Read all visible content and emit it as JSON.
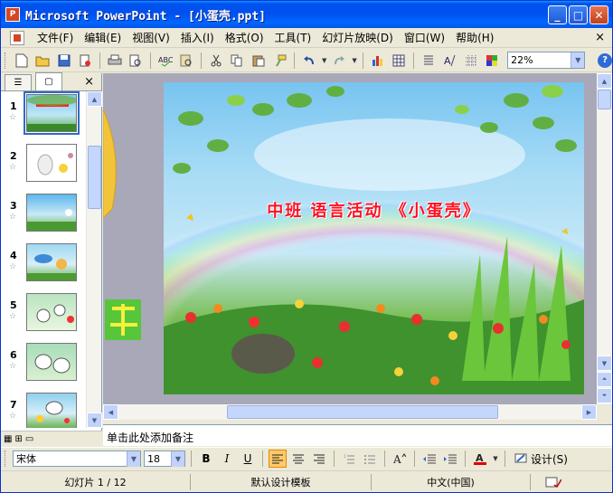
{
  "window": {
    "app_icon": "P",
    "title": "Microsoft PowerPoint - [小蛋壳.ppt]",
    "buttons": [
      "_",
      "□",
      "✕"
    ]
  },
  "menu": {
    "items": [
      "文件(F)",
      "编辑(E)",
      "视图(V)",
      "插入(I)",
      "格式(O)",
      "工具(T)",
      "幻灯片放映(D)",
      "窗口(W)",
      "帮助(H)"
    ],
    "close": "×"
  },
  "toolbar": {
    "zoom": "22%",
    "help_label": "?"
  },
  "left_pane": {
    "tab_outline": "☰",
    "tab_slides": "▢",
    "close": "×",
    "slide_numbers": [
      "1",
      "2",
      "3",
      "4",
      "5",
      "6",
      "7"
    ]
  },
  "slide": {
    "title": "中班 语言活动 《小蛋壳》"
  },
  "notes": {
    "placeholder": "单击此处添加备注"
  },
  "format_toolbar": {
    "font": "宋体",
    "size": "18",
    "bold": "B",
    "italic": "I",
    "underline": "U",
    "font_color_label": "A",
    "design_label": "设计(S)"
  },
  "status": {
    "slide_info": "幻灯片 1 / 12",
    "template": "默认设计模板",
    "language": "中文(中国)"
  },
  "colors": {
    "titlebar": "#0053ee",
    "slide_title": "#ff1020"
  }
}
